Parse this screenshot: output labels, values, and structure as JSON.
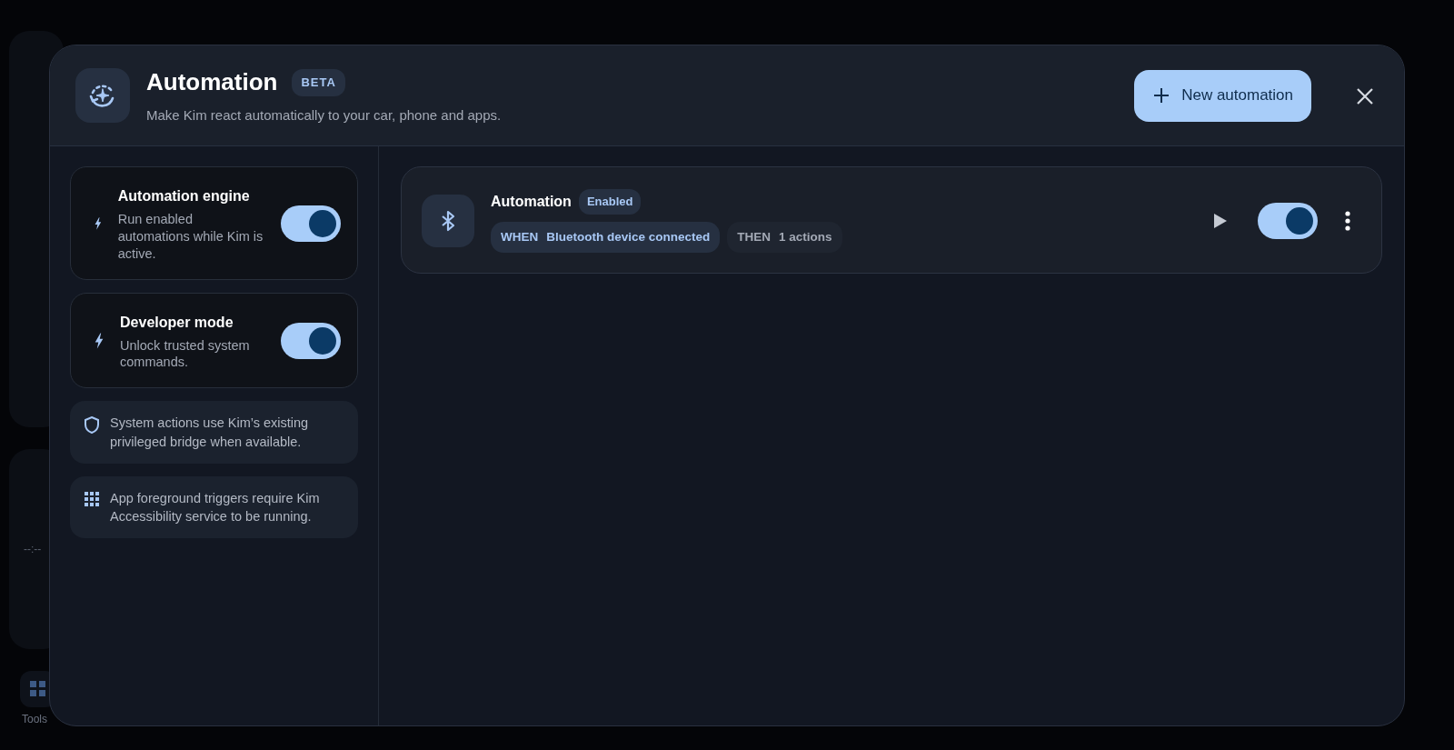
{
  "background": {
    "clock": "--:--",
    "nav_item": {
      "label": "Tools"
    }
  },
  "dialog": {
    "title": "Automation",
    "badge": "BETA",
    "subtitle": "Make Kim react automatically to your car, phone and apps.",
    "primary_button": "New automation"
  },
  "settings": [
    {
      "title": "Automation engine",
      "description": "Run enabled automations while Kim is active.",
      "on": true
    },
    {
      "title": "Developer mode",
      "description": "Unlock trusted system commands.",
      "on": true
    }
  ],
  "notes": [
    {
      "kind": "shield",
      "text": "System actions use Kim’s existing privileged bridge when available."
    },
    {
      "kind": "grid",
      "text": "App foreground triggers require Kim Accessibility service to be running."
    }
  ],
  "automations": [
    {
      "name": "Automation",
      "status": "Enabled",
      "trigger_label": "WHEN",
      "trigger": "Bluetooth device connected",
      "action_label": "THEN",
      "action": "1 actions",
      "on": true
    }
  ]
}
